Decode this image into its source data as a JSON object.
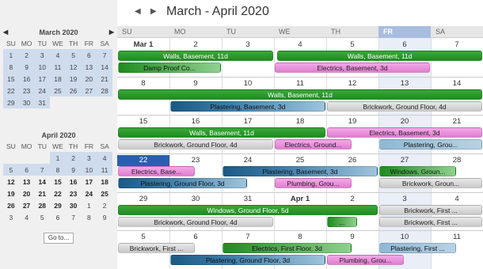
{
  "header": {
    "title": "March - April 2020",
    "prev_icon": "◀",
    "next_icon": "▶"
  },
  "weekdays": [
    "SU",
    "MO",
    "TU",
    "WE",
    "TH",
    "FR",
    "SA"
  ],
  "mini_weekdays": [
    "SU",
    "MO",
    "TU",
    "WE",
    "TH",
    "FR",
    "SA"
  ],
  "mini1": {
    "title": "March 2020",
    "rows": [
      [
        "1",
        "2",
        "3",
        "4",
        "5",
        "6",
        "7"
      ],
      [
        "8",
        "9",
        "10",
        "11",
        "12",
        "13",
        "14"
      ],
      [
        "15",
        "16",
        "17",
        "18",
        "19",
        "20",
        "21"
      ],
      [
        "22",
        "23",
        "24",
        "25",
        "26",
        "27",
        "28"
      ],
      [
        "29",
        "30",
        "31",
        "",
        "",
        "",
        ""
      ]
    ]
  },
  "mini2": {
    "title": "April 2020",
    "rows": [
      [
        "",
        "",
        "",
        "1",
        "2",
        "3",
        "4"
      ],
      [
        "5",
        "6",
        "7",
        "8",
        "9",
        "10",
        "11"
      ],
      [
        "12",
        "13",
        "14",
        "15",
        "16",
        "17",
        "18"
      ],
      [
        "19",
        "20",
        "21",
        "22",
        "23",
        "24",
        "25"
      ],
      [
        "26",
        "27",
        "28",
        "29",
        "30",
        "1",
        "2"
      ],
      [
        "3",
        "4",
        "5",
        "6",
        "7",
        "8",
        "9"
      ]
    ]
  },
  "goto_label": "Go to...",
  "weeks": [
    {
      "days": [
        "Mar 1",
        "2",
        "3",
        "4",
        "5",
        "6",
        "7"
      ]
    },
    {
      "days": [
        "8",
        "9",
        "10",
        "11",
        "12",
        "13",
        "14"
      ]
    },
    {
      "days": [
        "15",
        "16",
        "17",
        "18",
        "19",
        "20",
        "21"
      ]
    },
    {
      "days": [
        "22",
        "23",
        "24",
        "25",
        "26",
        "27",
        "28"
      ]
    },
    {
      "days": [
        "29",
        "30",
        "31",
        "Apr 1",
        "2",
        "3",
        "4"
      ]
    },
    {
      "days": [
        "5",
        "6",
        "7",
        "8",
        "9",
        "10",
        "11"
      ]
    }
  ],
  "events": [
    {
      "w": 0,
      "row": 0,
      "start": 0,
      "end": 3,
      "label": "Walls, Basement, 11d",
      "color": "green"
    },
    {
      "w": 0,
      "row": 0,
      "start": 3.05,
      "end": 7,
      "label": "Walls, Basement, 11d",
      "color": "green"
    },
    {
      "w": 0,
      "row": 1,
      "start": 0,
      "end": 2,
      "label": "Damp Proof Co...",
      "color": "lgreen"
    },
    {
      "w": 0,
      "row": 1,
      "start": 3,
      "end": 6,
      "label": "Electrics, Basement, 3d",
      "color": "pink"
    },
    {
      "w": 1,
      "row": 0,
      "start": 0,
      "end": 7,
      "label": "Walls, Basement, 11d",
      "color": "green"
    },
    {
      "w": 1,
      "row": 1,
      "start": 1,
      "end": 4,
      "label": "Plastering, Basement, 3d",
      "color": "blue"
    },
    {
      "w": 1,
      "row": 1,
      "start": 4,
      "end": 7,
      "label": "Brickwork, Ground Floor, 4d",
      "color": "gray"
    },
    {
      "w": 2,
      "row": 0,
      "start": 0,
      "end": 4,
      "label": "Walls, Basement, 11d",
      "color": "green"
    },
    {
      "w": 2,
      "row": 0,
      "start": 4,
      "end": 7,
      "label": "Electrics, Basement, 3d",
      "color": "pink"
    },
    {
      "w": 2,
      "row": 1,
      "start": 0,
      "end": 3,
      "label": "Brickwork, Ground Floor, 4d",
      "color": "gray"
    },
    {
      "w": 2,
      "row": 1,
      "start": 3,
      "end": 4.5,
      "label": "Electrics, Ground...",
      "color": "pink"
    },
    {
      "w": 2,
      "row": 1,
      "start": 5,
      "end": 7,
      "label": "Plastering, Grou...",
      "color": "blue2"
    },
    {
      "w": 3,
      "row": 0,
      "start": 0,
      "end": 1.5,
      "label": "Electrics, Base...",
      "color": "pink"
    },
    {
      "w": 3,
      "row": 0,
      "start": 2,
      "end": 5,
      "label": "Plastering, Basement, 3d",
      "color": "blue"
    },
    {
      "w": 3,
      "row": 0,
      "start": 5,
      "end": 6.5,
      "label": "Windows, Groun...",
      "color": "lgreen"
    },
    {
      "w": 3,
      "row": 1,
      "start": 0,
      "end": 2.5,
      "label": "Plastering, Ground Floor, 3d",
      "color": "blue"
    },
    {
      "w": 3,
      "row": 1,
      "start": 3,
      "end": 4.5,
      "label": "Plumbing, Grou...",
      "color": "pink"
    },
    {
      "w": 3,
      "row": 1,
      "start": 5,
      "end": 7,
      "label": "Brickwork, Groun...",
      "color": "gray"
    },
    {
      "w": 4,
      "row": 0,
      "start": 0,
      "end": 5,
      "label": "Windows, Ground Floor, 5d",
      "color": "green"
    },
    {
      "w": 4,
      "row": 0,
      "start": 5,
      "end": 7,
      "label": "Brickwork, First ...",
      "color": "gray"
    },
    {
      "w": 4,
      "row": 1,
      "start": 0,
      "end": 3,
      "label": "Brickwork, Ground Floor, 4d",
      "color": "gray"
    },
    {
      "w": 4,
      "row": 1,
      "start": 4,
      "end": 4.6,
      "label": "...",
      "color": "lgreen"
    },
    {
      "w": 4,
      "row": 1,
      "start": 5,
      "end": 7,
      "label": "Brickwork, First ...",
      "color": "gray"
    },
    {
      "w": 5,
      "row": 0,
      "start": 0,
      "end": 1.5,
      "label": "Brickwork, First ...",
      "color": "gray"
    },
    {
      "w": 5,
      "row": 0,
      "start": 2,
      "end": 4.5,
      "label": "Electrics, First Floor, 3d",
      "color": "lgreen"
    },
    {
      "w": 5,
      "row": 0,
      "start": 5,
      "end": 6.5,
      "label": "Plastering, First ...",
      "color": "blue2"
    },
    {
      "w": 5,
      "row": 1,
      "start": 1,
      "end": 4,
      "label": "Plastering, Ground Floor, 3d",
      "color": "blue"
    },
    {
      "w": 5,
      "row": 1,
      "start": 4,
      "end": 5.5,
      "label": "Plumbing, Grou...",
      "color": "pink"
    }
  ]
}
